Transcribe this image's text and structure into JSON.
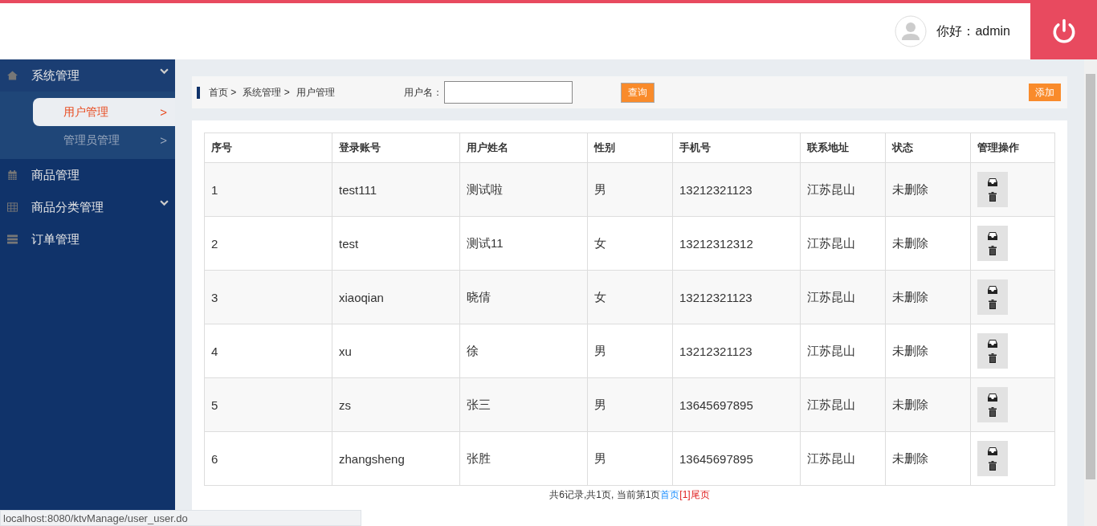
{
  "header": {
    "greeting": "你好：admin"
  },
  "sidebar": {
    "items": [
      {
        "label": "系统管理",
        "expandable": true,
        "expanded": true,
        "children": [
          {
            "label": "用户管理",
            "arrow": ">",
            "selected": true
          },
          {
            "label": "管理员管理",
            "arrow": ">",
            "selected": false
          }
        ]
      },
      {
        "label": "商品管理",
        "expandable": false,
        "expanded": false
      },
      {
        "label": "商品分类管理",
        "expandable": true,
        "expanded": false
      },
      {
        "label": "订单管理",
        "expandable": false,
        "expanded": false
      }
    ]
  },
  "breadcrumb": [
    "首页 >",
    "系统管理 >",
    "用户管理"
  ],
  "search": {
    "label": "用户名：",
    "button": "查询"
  },
  "add_button": "添加",
  "table": {
    "columns": [
      "序号",
      "登录账号",
      "用户姓名",
      "性别",
      "手机号",
      "联系地址",
      "状态",
      "管理操作"
    ],
    "rows": [
      [
        "1",
        "test111",
        "测试啦",
        "男",
        "13212321123",
        "江苏昆山",
        "未删除"
      ],
      [
        "2",
        "test",
        "测试11",
        "女",
        "13212312312",
        "江苏昆山",
        "未删除"
      ],
      [
        "3",
        "xiaoqian",
        "晓倩",
        "女",
        "13212321123",
        "江苏昆山",
        "未删除"
      ],
      [
        "4",
        "xu",
        "徐",
        "男",
        "13212321123",
        "江苏昆山",
        "未删除"
      ],
      [
        "5",
        "zs",
        "张三",
        "男",
        "13645697895",
        "江苏昆山",
        "未删除"
      ],
      [
        "6",
        "zhangsheng",
        "张胜",
        "男",
        "13645697895",
        "江苏昆山",
        "未删除"
      ]
    ]
  },
  "pagination": {
    "summary": "共6记录,共1页, 当前第1页",
    "first": "首页",
    "page": "[1]",
    "last": "尾页"
  },
  "status_bar": "localhost:8080/ktvManage/user_user.do"
}
